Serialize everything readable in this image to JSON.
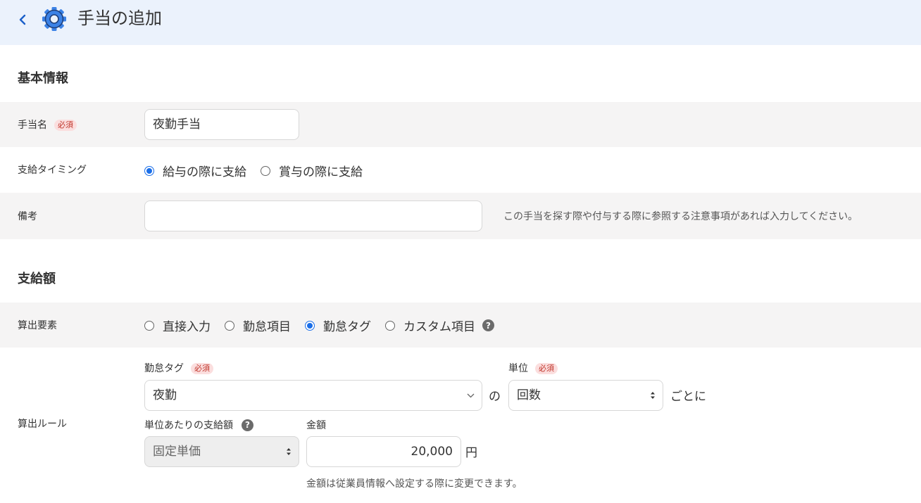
{
  "header": {
    "title": "手当の追加",
    "back_icon": "chevron-left-icon",
    "page_icon": "gear-icon",
    "accent": "#1a6ee8"
  },
  "basic": {
    "section_title": "基本情報",
    "name_label": "手当名",
    "required_badge": "必須",
    "name_value": "夜勤手当",
    "timing_label": "支給タイミング",
    "timing_options": [
      {
        "label": "給与の際に支給",
        "selected": true
      },
      {
        "label": "賞与の際に支給",
        "selected": false
      }
    ],
    "note_label": "備考",
    "note_value": "",
    "note_hint": "この手当を探す際や付与する際に参照する注意事項があれば入力してください。"
  },
  "amount": {
    "section_title": "支給額",
    "element_label": "算出要素",
    "element_options": [
      {
        "label": "直接入力",
        "selected": false
      },
      {
        "label": "勤怠項目",
        "selected": false
      },
      {
        "label": "勤怠タグ",
        "selected": true
      },
      {
        "label": "カスタム項目",
        "selected": false
      }
    ],
    "rule_label": "算出ルール",
    "tag_label": "勤怠タグ",
    "tag_value": "夜勤",
    "of_text": "の",
    "unit_label": "単位",
    "unit_value": "回数",
    "per_text": "ごとに",
    "unit_amount_label": "単位あたりの支給額",
    "unit_amount_value": "固定単価",
    "money_label": "金額",
    "money_value": "20,000",
    "yen_text": "円",
    "money_hint": "金額は従業員情報へ設定する際に変更できます。"
  }
}
